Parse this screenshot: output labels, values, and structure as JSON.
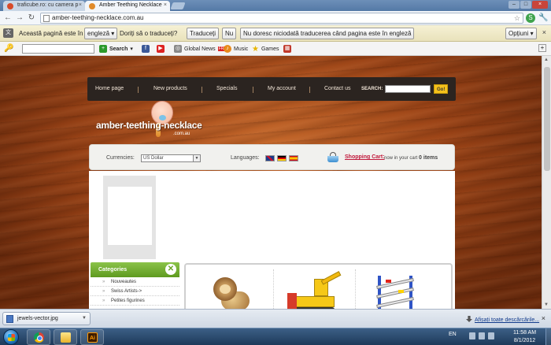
{
  "browser": {
    "tabs": [
      {
        "label": "traficube.ro: cu camera p"
      },
      {
        "label": "Amber Teething Necklace"
      }
    ],
    "url": "amber-teething-necklace.com.au"
  },
  "translate_bar": {
    "text1": "Această pagină este în",
    "language": "engleză",
    "text2": "Doriți să o traduceți?",
    "translate_btn": "Traduceți",
    "no_btn": "Nu",
    "never_btn": "Nu doresc niciodată traducerea când pagina este în engleză",
    "options_btn": "Opțiuni"
  },
  "search_toolbar": {
    "search_label": "Search",
    "items": [
      "Global News",
      "Music",
      "Games"
    ],
    "news_badge": "FREE"
  },
  "site": {
    "nav": [
      "Home page",
      "New products",
      "Specials",
      "My account",
      "Contact us"
    ],
    "search_label": "SEARCH:",
    "go_label": "Go!",
    "logo_name": "amber-teething-necklace",
    "logo_sub": ".com.au",
    "currencies_label": "Currencies:",
    "currency_value": "US Dollar",
    "languages_label": "Languages:",
    "cart_link": "Shopping Cart:",
    "cart_info": "now in your cart",
    "cart_count": "0 items",
    "categories_title": "Categories",
    "categories": [
      "Nouveautes",
      "Swiss Artists->",
      "Petites figurines"
    ]
  },
  "downloads": {
    "file": "jewels-vector.jpg",
    "show_all": "Afișați toate descărcările..."
  },
  "taskbar": {
    "lang": "EN",
    "time": "11:58 AM",
    "date": "8/1/2012",
    "ai_label": "Ai"
  }
}
